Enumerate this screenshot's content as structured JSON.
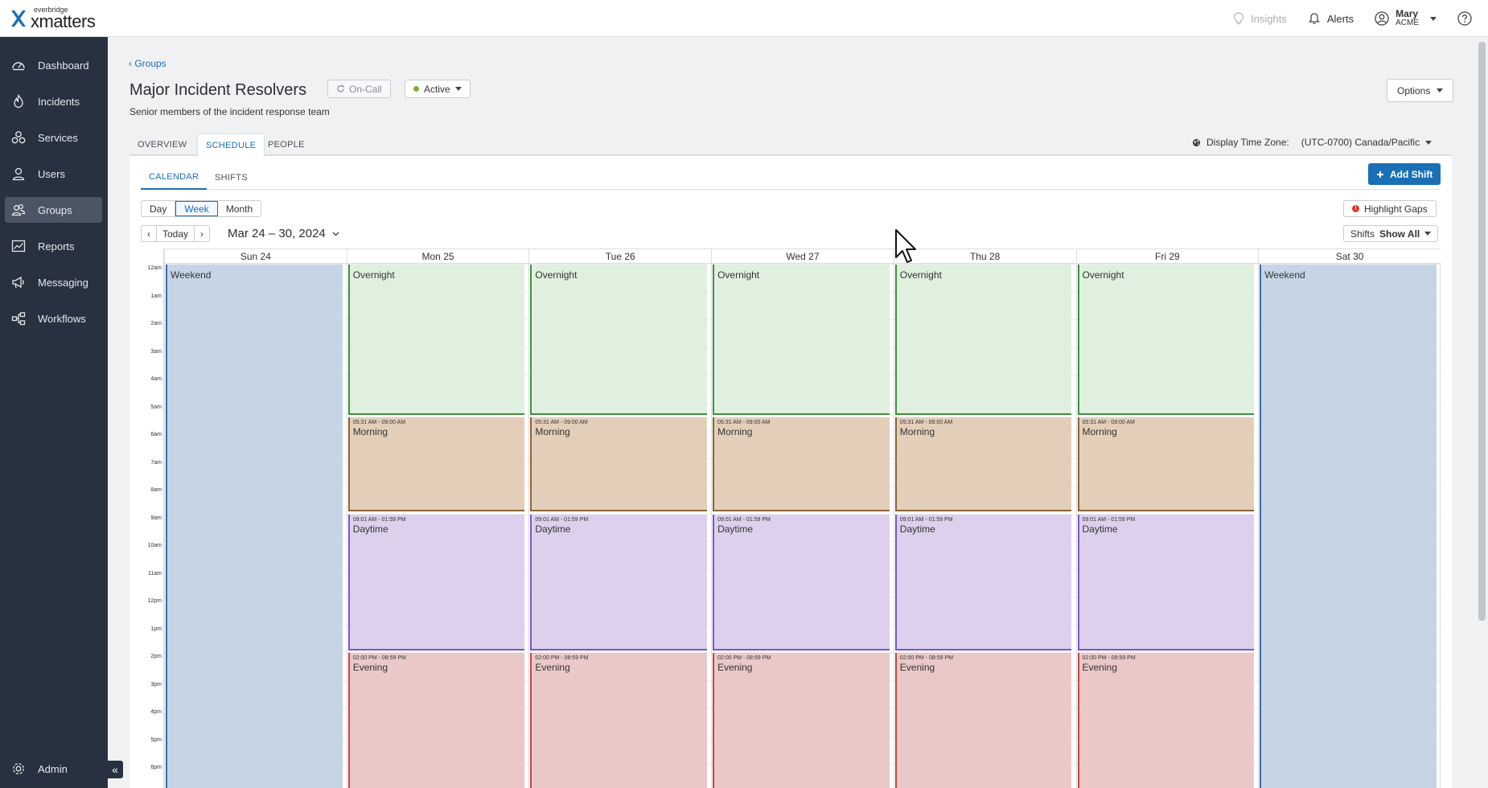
{
  "app": {
    "brand_small": "everbridge",
    "brand_name": "xmatters"
  },
  "topbar": {
    "insights": "Insights",
    "alerts": "Alerts",
    "user_name": "Mary",
    "user_org": "ACME"
  },
  "sidebar": {
    "items": [
      {
        "label": "Dashboard",
        "icon": "dashboard-icon"
      },
      {
        "label": "Incidents",
        "icon": "flame-icon"
      },
      {
        "label": "Services",
        "icon": "services-icon"
      },
      {
        "label": "Users",
        "icon": "user-icon"
      },
      {
        "label": "Groups",
        "icon": "groups-icon",
        "active": true
      },
      {
        "label": "Reports",
        "icon": "reports-icon"
      },
      {
        "label": "Messaging",
        "icon": "megaphone-icon"
      },
      {
        "label": "Workflows",
        "icon": "workflow-icon"
      }
    ],
    "admin": "Admin",
    "collapse": "«"
  },
  "page": {
    "breadcrumb": "‹ Groups",
    "title": "Major Incident Resolvers",
    "oncall": "On-Call",
    "status": "Active",
    "subtitle": "Senior members of the incident response team",
    "options": "Options",
    "tabs": [
      "OVERVIEW",
      "SCHEDULE",
      "PEOPLE"
    ],
    "selected_tab": "SCHEDULE",
    "tz_label": "Display Time Zone:",
    "tz_value": "(UTC-0700) Canada/Pacific"
  },
  "schedule": {
    "subtabs": [
      "CALENDAR",
      "SHIFTS"
    ],
    "add_shift": "Add Shift",
    "views": [
      "Day",
      "Week",
      "Month"
    ],
    "selected_view": "Week",
    "highlight_gaps": "Highlight Gaps",
    "today": "Today",
    "prev": "‹",
    "next": "›",
    "range": "Mar 24 – 30, 2024",
    "shifts_label": "Shifts",
    "shifts_filter": "Show All"
  },
  "calendar": {
    "days": [
      "Sun 24",
      "Mon 25",
      "Tue 26",
      "Wed 27",
      "Thu 28",
      "Fri 29",
      "Sat 30"
    ],
    "hours": [
      "12am",
      "1am",
      "2am",
      "3am",
      "4am",
      "5am",
      "6am",
      "7am",
      "8am",
      "9am",
      "10am",
      "11am",
      "12pm",
      "1pm",
      "2pm",
      "3pm",
      "4pm",
      "5pm",
      "6pm"
    ],
    "weekday_shifts": [
      {
        "name": "Overnight",
        "time": ""
      },
      {
        "name": "Morning",
        "time": "05:31 AM - 09:00 AM"
      },
      {
        "name": "Daytime",
        "time": "09:01 AM - 01:59 PM"
      },
      {
        "name": "Evening",
        "time": "02:00 PM - 08:59 PM"
      }
    ],
    "weekend_shift": {
      "name": "Weekend"
    }
  },
  "colors": {
    "accent": "#1a6fb5",
    "sidebar": "#27313f",
    "weekend": "#c6d5e6",
    "overnight": "#dff0df",
    "morning": "#e3cfb9",
    "daytime": "#dcd0ec",
    "evening": "#ebc8c8"
  }
}
